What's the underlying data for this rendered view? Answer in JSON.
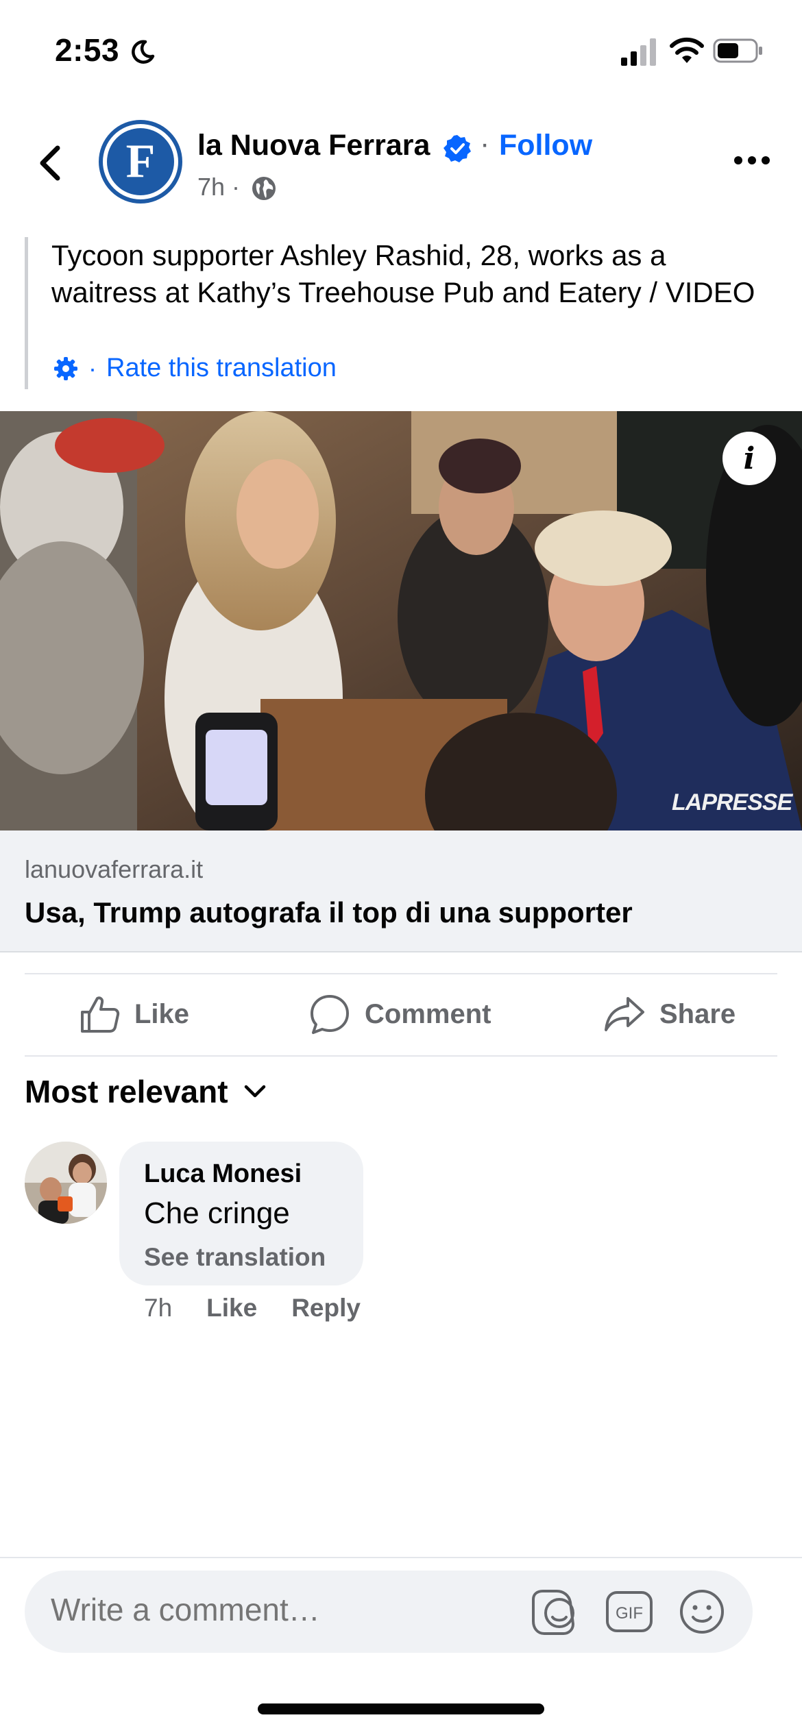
{
  "status_bar": {
    "time": "2:53"
  },
  "header": {
    "page_name": "la Nuova Ferrara",
    "separator": "·",
    "follow_label": "Follow",
    "post_age": "7h ·",
    "avatar_letter": "F"
  },
  "post": {
    "caption": "Tycoon supporter Ashley Rashid, 28, works as a waitress at Kathy’s Treehouse Pub and Eatery / VIDEO",
    "rate_separator": "·",
    "rate_translation": "Rate this translation",
    "media": {
      "watermark": "LAPRESSE",
      "info_icon": "i"
    },
    "link": {
      "domain": "lanuovaferrara.it",
      "title": "Usa, Trump autografa il top di una supporter"
    }
  },
  "actions": {
    "like": "Like",
    "comment": "Comment",
    "share": "Share"
  },
  "comments": {
    "sort_label": "Most relevant",
    "items": [
      {
        "author": "Luca Monesi",
        "text": "Che cringe",
        "translate": "See translation",
        "time": "7h",
        "like": "Like",
        "reply": "Reply"
      }
    ]
  },
  "composer": {
    "placeholder": "Write a comment…",
    "gif_label": "GIF"
  },
  "colors": {
    "accent": "#0866ff",
    "brand_blue": "#1d5aa6",
    "secondary_text": "#65676b",
    "surface": "#f0f2f5"
  }
}
